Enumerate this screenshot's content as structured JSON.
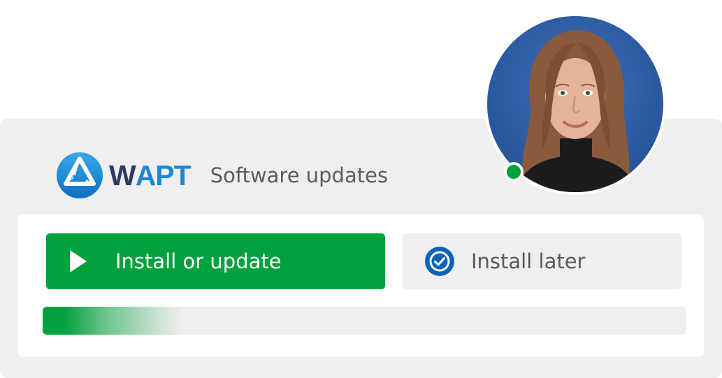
{
  "app": {
    "brand_prefix": "W",
    "brand_suffix": "APT",
    "title": "Software updates"
  },
  "actions": {
    "primary_label": "Install or update",
    "secondary_label": "Install later"
  },
  "progress": {
    "value_fraction": 0.22
  },
  "user": {
    "status": "online",
    "status_color": "#03a13d"
  },
  "colors": {
    "accent_green": "#03a13d",
    "brand_blue": "#1c88d3",
    "brand_navy": "#2d3b63"
  },
  "icons": {
    "logo": "wapt-logo-icon",
    "play": "play-icon",
    "later": "clock-check-icon"
  }
}
